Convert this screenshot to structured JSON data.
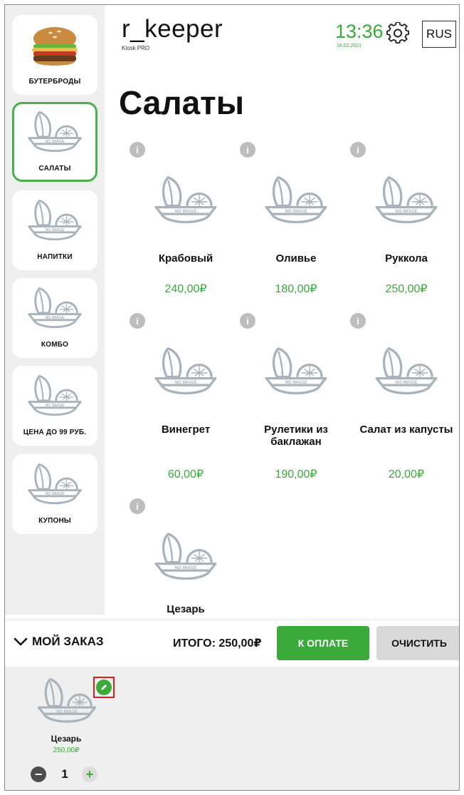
{
  "header": {
    "brand": "r_keeper",
    "brand_sub": "Kiosk PRO",
    "time": "13:36",
    "date": "18.02.2021",
    "language": "RUS"
  },
  "sidebar": {
    "items": [
      {
        "label": "БУТЕРБРОДЫ",
        "active": false,
        "icon": "burger-photo"
      },
      {
        "label": "САЛАТЫ",
        "active": true,
        "icon": "no-image-icon"
      },
      {
        "label": "НАПИТКИ",
        "active": false,
        "icon": "no-image-icon"
      },
      {
        "label": "КОМБО",
        "active": false,
        "icon": "no-image-icon"
      },
      {
        "label": "ЦЕНА ДО 99 РУБ.",
        "active": false,
        "icon": "no-image-icon"
      },
      {
        "label": "КУПОНЫ",
        "active": false,
        "icon": "no-image-icon"
      }
    ]
  },
  "main": {
    "title": "Салаты",
    "products": [
      {
        "name": "Крабовый",
        "price": "240,00₽"
      },
      {
        "name": "Оливье",
        "price": "180,00₽"
      },
      {
        "name": "Руккола",
        "price": "250,00₽"
      },
      {
        "name": "Винегрет",
        "price": "60,00₽"
      },
      {
        "name": "Рулетики из баклажан",
        "price": "190,00₽"
      },
      {
        "name": "Салат из капусты",
        "price": "20,00₽"
      },
      {
        "name": "Цезарь",
        "price": ""
      }
    ],
    "info_glyph": "i",
    "no_image_text": "NO IMAGE"
  },
  "order": {
    "toggle_label": "МОЙ ЗАКАЗ",
    "total_label": "ИТОГО: 250,00₽",
    "pay_label": "К ОПЛАТЕ",
    "clear_label": "ОЧИСТИТЬ",
    "items": [
      {
        "name": "Цезарь",
        "price": "250,00₽",
        "qty": "1"
      }
    ]
  },
  "colors": {
    "accent": "#3aaa3a",
    "sidebar_bg": "#efefef",
    "highlight": "#e21b1b"
  }
}
